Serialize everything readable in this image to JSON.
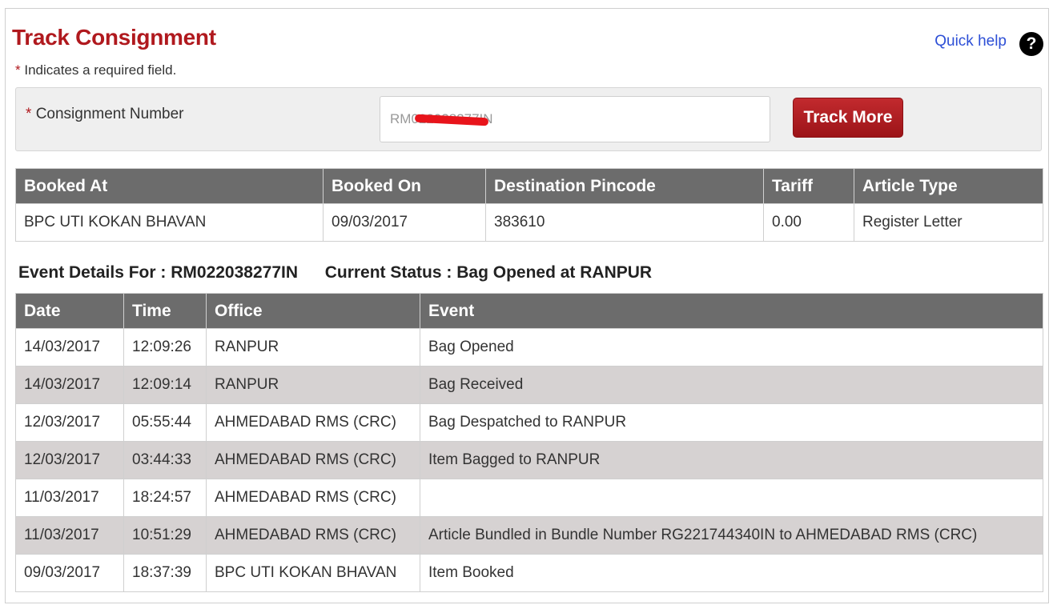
{
  "header": {
    "title": "Track Consignment",
    "quick_help": "Quick help",
    "help_icon": "?",
    "required_star": "*",
    "required_note": "Indicates a required field."
  },
  "search": {
    "required_star": "*",
    "label": "Consignment Number",
    "value": "RM022038277IN",
    "track_more_label": "Track More"
  },
  "booking": {
    "headers": [
      "Booked At",
      "Booked On",
      "Destination Pincode",
      "Tariff",
      "Article Type"
    ],
    "row": [
      "BPC UTI KOKAN BHAVAN",
      "09/03/2017",
      "383610",
      "0.00",
      "Register Letter"
    ]
  },
  "event_details": {
    "label": "Event Details For :",
    "consignment": "RM022038277IN",
    "status_label": "Current Status :",
    "status_value": "Bag Opened at RANPUR"
  },
  "events": {
    "headers": [
      "Date",
      "Time",
      "Office",
      "Event"
    ],
    "rows": [
      [
        "14/03/2017",
        "12:09:26",
        "RANPUR",
        "Bag Opened"
      ],
      [
        "14/03/2017",
        "12:09:14",
        "RANPUR",
        "Bag Received"
      ],
      [
        "12/03/2017",
        "05:55:44",
        "AHMEDABAD RMS (CRC)",
        "Bag Despatched to RANPUR"
      ],
      [
        "12/03/2017",
        "03:44:33",
        "AHMEDABAD RMS (CRC)",
        "Item Bagged to RANPUR"
      ],
      [
        "11/03/2017",
        "18:24:57",
        "AHMEDABAD RMS (CRC)",
        ""
      ],
      [
        "11/03/2017",
        "10:51:29",
        "AHMEDABAD RMS (CRC)",
        "Article Bundled in Bundle Number RG221744340IN to AHMEDABAD RMS (CRC)"
      ],
      [
        "09/03/2017",
        "18:37:39",
        "BPC UTI KOKAN BHAVAN",
        "Item Booked"
      ]
    ]
  },
  "colors": {
    "title_red": "#b0191e",
    "header_gray": "#6c6c6c",
    "stripe_gray": "#d6d2d2",
    "link_blue": "#2d4fd6"
  }
}
